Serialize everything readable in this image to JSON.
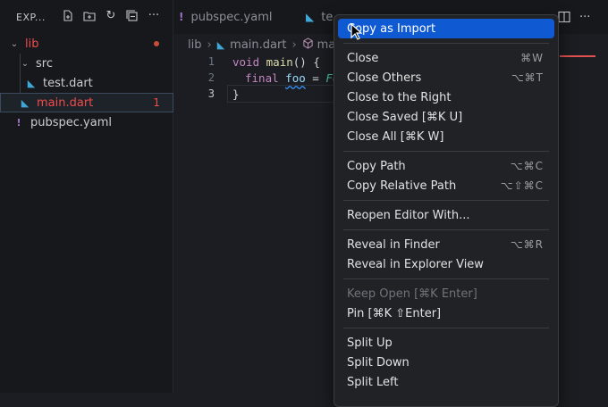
{
  "sidebar": {
    "title": "EXP...",
    "tree": [
      {
        "label": "lib",
        "type": "folder"
      },
      {
        "label": "src",
        "type": "folder"
      },
      {
        "label": "test.dart",
        "type": "file"
      },
      {
        "label": "main.dart",
        "type": "file",
        "problems": "1"
      },
      {
        "label": "pubspec.yaml",
        "type": "file"
      }
    ]
  },
  "tabs": [
    {
      "label": "pubspec.yaml"
    },
    {
      "label": "te"
    }
  ],
  "breadcrumb": {
    "folder": "lib",
    "file": "main.dart",
    "symbol": "ma"
  },
  "editor": {
    "line_numbers": [
      "1",
      "2",
      "3"
    ],
    "line1": {
      "kw": "void",
      "fn": "main",
      "rest": "() {"
    },
    "line2": {
      "kw": "final",
      "var": "foo",
      "eq": " = ",
      "cls": "Fo"
    },
    "line3": {
      "text": "}"
    }
  },
  "context_menu": {
    "items": [
      {
        "label": "Copy as Import",
        "shortcut": ""
      },
      {
        "label": "Close",
        "shortcut": "⌘W"
      },
      {
        "label": "Close Others",
        "shortcut": "⌥⌘T"
      },
      {
        "label": "Close to the Right",
        "shortcut": ""
      },
      {
        "label": "Close Saved [⌘K U]",
        "shortcut": ""
      },
      {
        "label": "Close All [⌘K W]",
        "shortcut": ""
      },
      {
        "label": "Copy Path",
        "shortcut": "⌥⌘C"
      },
      {
        "label": "Copy Relative Path",
        "shortcut": "⌥⇧⌘C"
      },
      {
        "label": "Reopen Editor With...",
        "shortcut": ""
      },
      {
        "label": "Reveal in Finder",
        "shortcut": "⌥⌘R"
      },
      {
        "label": "Reveal in Explorer View",
        "shortcut": ""
      },
      {
        "label": "Keep Open [⌘K Enter]",
        "shortcut": ""
      },
      {
        "label": "Pin [⌘K ⇧Enter]",
        "shortcut": ""
      },
      {
        "label": "Split Up",
        "shortcut": ""
      },
      {
        "label": "Split Down",
        "shortcut": ""
      },
      {
        "label": "Split Left",
        "shortcut": ""
      }
    ]
  },
  "colors": {
    "accent": "#0f5ad3",
    "error": "#f14c4c",
    "dart_icon": "#3fa7d6",
    "yaml_icon": "#a074c4"
  },
  "icons": [
    "new-file-icon",
    "new-folder-icon",
    "refresh-icon",
    "collapse-all-icon",
    "more-icon",
    "split-editor-icon",
    "dart-file-icon",
    "yaml-file-icon",
    "chevron-down-icon",
    "cube-icon",
    "mouse-pointer-icon"
  ]
}
